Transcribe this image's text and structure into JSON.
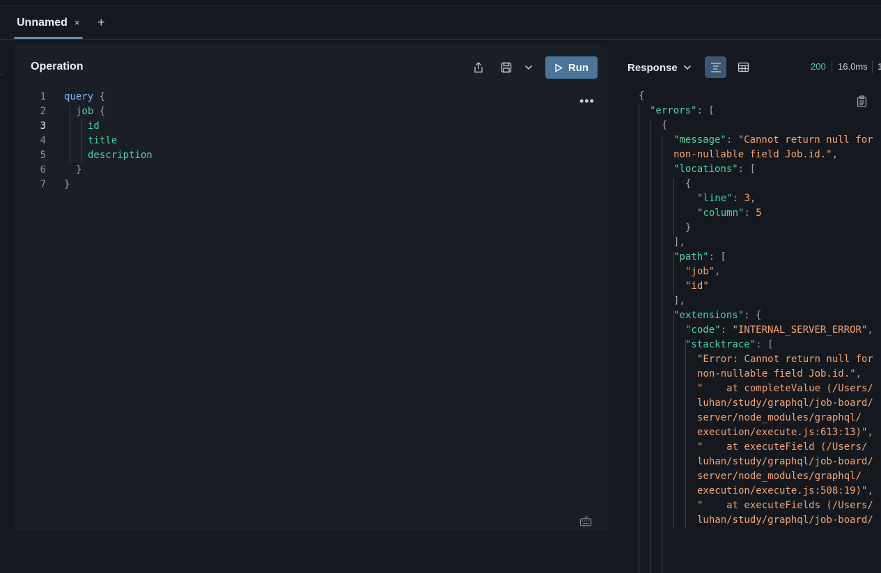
{
  "tabs": [
    {
      "label": "Unnamed",
      "close_icon": "×"
    }
  ],
  "add_tab_label": "+",
  "operation": {
    "title": "Operation",
    "run_label": "Run",
    "line_numbers": [
      "1",
      "2",
      "3",
      "4",
      "5",
      "6",
      "7"
    ],
    "lines": [
      {
        "kw": "query",
        "punc": " {"
      },
      {
        "fld": "job",
        "punc": " {"
      },
      {
        "fld": "id"
      },
      {
        "fld": "title"
      },
      {
        "fld": "description"
      },
      {
        "punc": "}"
      },
      {
        "punc": "}"
      }
    ],
    "more_label": "•••"
  },
  "response": {
    "title": "Response",
    "status_code": "200",
    "time": "16.0ms",
    "size_partial": "1",
    "body": [
      {
        "t": "p",
        "v": "{"
      },
      {
        "k": "\"errors\"",
        "rest": ": ["
      },
      {
        "t": "p",
        "v": "{"
      },
      {
        "k": "\"message\"",
        "rest": ": ",
        "s": "\"Cannot return null for"
      },
      {
        "s": "non-nullable field Job.id.\"",
        "rest": ","
      },
      {
        "k": "\"locations\"",
        "rest": ": ["
      },
      {
        "t": "p",
        "v": "{"
      },
      {
        "k": "\"line\"",
        "rest": ": ",
        "n": "3",
        "rest2": ","
      },
      {
        "k": "\"column\"",
        "rest": ": ",
        "n": "5"
      },
      {
        "t": "p",
        "v": "}"
      },
      {
        "t": "p",
        "v": "],"
      },
      {
        "k": "\"path\"",
        "rest": ": ["
      },
      {
        "s": "\"job\"",
        "rest": ","
      },
      {
        "s": "\"id\""
      },
      {
        "t": "p",
        "v": "],"
      },
      {
        "k": "\"extensions\"",
        "rest": ": {"
      },
      {
        "k": "\"code\"",
        "rest": ": ",
        "s": "\"INTERNAL_SERVER_ERROR\"",
        "rest2": ","
      },
      {
        "k": "\"stacktrace\"",
        "rest": ": ["
      },
      {
        "s": "\"Error: Cannot return null for"
      },
      {
        "s": "non-nullable field Job.id.\"",
        "rest": ","
      },
      {
        "s": "\"    at completeValue (/Users/"
      },
      {
        "s": "luhan/study/graphql/job-board/"
      },
      {
        "s": "server/node_modules/graphql/"
      },
      {
        "s": "execution/execute.js:613:13)\"",
        "rest": ","
      },
      {
        "s": "\"    at executeField (/Users/"
      },
      {
        "s": "luhan/study/graphql/job-board/"
      },
      {
        "s": "server/node_modules/graphql/"
      },
      {
        "s": "execution/execute.js:508:19)\"",
        "rest": ","
      },
      {
        "s": "\"    at executeFields (/Users/"
      },
      {
        "s": "luhan/study/graphql/job-board/"
      }
    ]
  },
  "icons": {
    "share": "share-icon",
    "save": "save-icon",
    "chevron": "chevron-down-icon",
    "play": "play-icon",
    "tree_view": "tree-view-icon",
    "table_view": "table-view-icon",
    "copy": "clipboard-icon",
    "keyboard": "keyboard-icon"
  },
  "colors": {
    "accent": "#4a7498",
    "status_ok": "#4fd1a5",
    "string": "#f2a477",
    "key": "#4fd1a5",
    "keyword": "#8ab4f8"
  }
}
